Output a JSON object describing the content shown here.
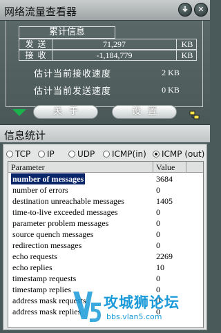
{
  "window": {
    "title": "网络流量查看器",
    "minimize_icon": "pin-icon",
    "close_label": "✕"
  },
  "traffic": {
    "header": "累计信息",
    "send_label": "发送",
    "send_value": "71,297",
    "send_unit": "KB",
    "recv_label": "接收",
    "recv_value": "-1,184,779",
    "recv_unit": "KB",
    "recv_speed_label": "估计当前接收速度",
    "recv_speed_value": "2 KB",
    "send_speed_label": "估计当前发送速度",
    "send_speed_value": "0 KB"
  },
  "buttons": {
    "about": "关于",
    "settings": "设置"
  },
  "stats": {
    "title": "信息统计",
    "tabs": [
      {
        "label": "TCP",
        "selected": false
      },
      {
        "label": "IP",
        "selected": false
      },
      {
        "label": "UDP",
        "selected": false
      },
      {
        "label": "ICMP(in)",
        "selected": false
      },
      {
        "label": "ICMP (out)",
        "selected": true
      }
    ],
    "columns": {
      "parameter": "Parameter",
      "value": "Value"
    },
    "rows": [
      {
        "parameter": "number of messages",
        "value": "3684"
      },
      {
        "parameter": "number of errors",
        "value": "0"
      },
      {
        "parameter": "destination unreachable messages",
        "value": "1405"
      },
      {
        "parameter": "time-to-live exceeded messages",
        "value": "0"
      },
      {
        "parameter": "parameter problem messages",
        "value": "0"
      },
      {
        "parameter": "source quench messages",
        "value": "0"
      },
      {
        "parameter": "redirection messages",
        "value": "0"
      },
      {
        "parameter": "echo requests",
        "value": "2269"
      },
      {
        "parameter": "echo replies",
        "value": "10"
      },
      {
        "parameter": "timestamp requests",
        "value": "0"
      },
      {
        "parameter": "timestamp replies",
        "value": "0"
      },
      {
        "parameter": "address mask requests",
        "value": "0"
      },
      {
        "parameter": "address mask replies",
        "value": "0"
      }
    ]
  },
  "watermark": {
    "logo": "V5",
    "text": "攻城狮论坛",
    "url": "bbs.vlan5.com"
  },
  "colors": {
    "panel_bg": "#4a5a5a",
    "accent_green": "#19b24c",
    "selection": "#0a246a",
    "watermark_blue": "#1a9ad8"
  }
}
